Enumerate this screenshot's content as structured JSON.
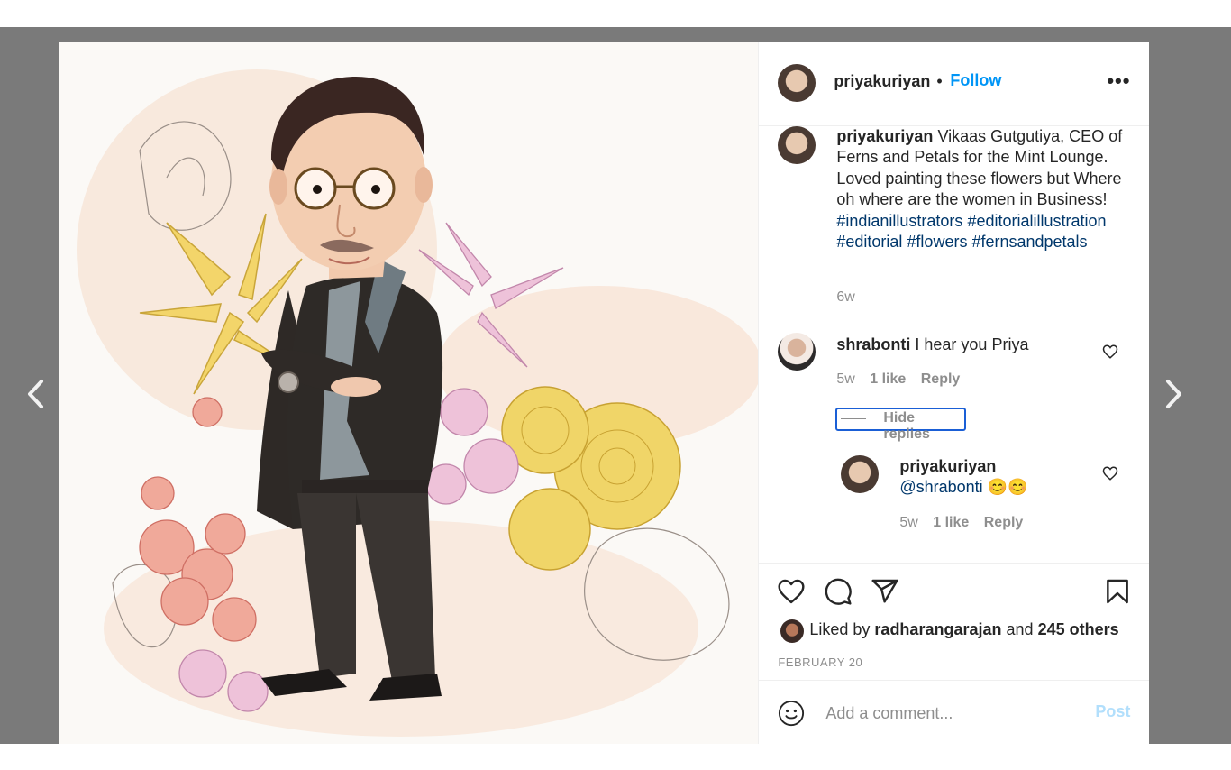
{
  "navigation": {
    "prev_icon": "chevron-left-icon",
    "next_icon": "chevron-right-icon"
  },
  "colors": {
    "overlay": "#7a7a7a",
    "link_blue": "#0095f6",
    "hashtag": "#00376b",
    "muted": "#8e8e8e",
    "text": "#262626",
    "post_disabled": "#b2dffc",
    "focus_ring": "#1a5fd6"
  },
  "header": {
    "username": "priyakuriyan",
    "separator": "•",
    "follow_label": "Follow",
    "more_label": "•••"
  },
  "caption": {
    "username": "priyakuriyan",
    "text": "Vikaas Gutgutiya, CEO of Ferns and Petals for the Mint Lounge. Loved painting these flowers but Where oh where are the women in Business!",
    "hashtags": [
      "#indianillustrators",
      "#editorialillustration",
      "#editorial",
      "#flowers",
      "#fernsandpetals"
    ],
    "time": "6w"
  },
  "comments": [
    {
      "username": "shrabonti",
      "text": "I hear you Priya",
      "time": "5w",
      "likes": "1 like",
      "reply_label": "Reply",
      "hide_replies_label": "Hide replies",
      "replies": [
        {
          "username": "priyakuriyan",
          "mention": "@shrabonti",
          "emoji": "😊😊",
          "time": "5w",
          "likes": "1 like",
          "reply_label": "Reply"
        }
      ]
    }
  ],
  "actions": {
    "icons": [
      "heart-icon",
      "comment-icon",
      "share-icon",
      "bookmark-icon"
    ]
  },
  "likes": {
    "prefix": "Liked by",
    "user": "radharangarajan",
    "conjunction": "and",
    "others": "245 others"
  },
  "date": "FEBRUARY 20",
  "comment_box": {
    "placeholder": "Add a comment...",
    "post_label": "Post"
  }
}
